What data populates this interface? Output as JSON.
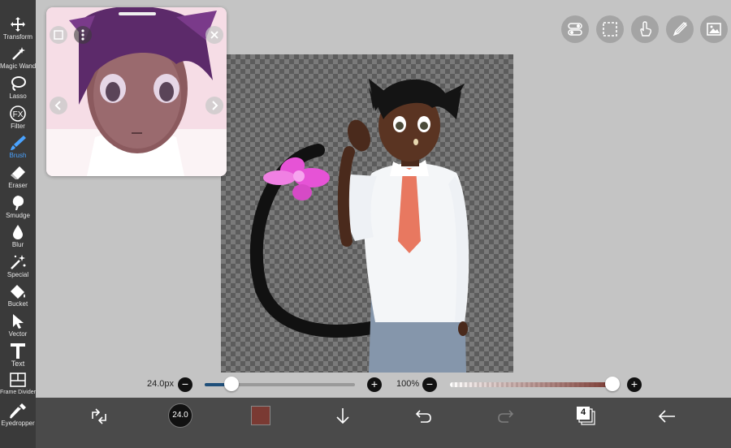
{
  "toolbar": {
    "tools": [
      {
        "label": "Transform",
        "icon": "move-arrows-icon"
      },
      {
        "label": "Magic Wand",
        "icon": "magic-wand-icon"
      },
      {
        "label": "Lasso",
        "icon": "lasso-icon"
      },
      {
        "label": "Filter",
        "icon": "fx-icon"
      },
      {
        "label": "Brush",
        "icon": "brush-icon",
        "active": true
      },
      {
        "label": "Eraser",
        "icon": "eraser-icon"
      },
      {
        "label": "Smudge",
        "icon": "smudge-icon"
      },
      {
        "label": "Blur",
        "icon": "drop-icon"
      },
      {
        "label": "Special",
        "icon": "sparkle-icon"
      },
      {
        "label": "Bucket",
        "icon": "bucket-icon"
      },
      {
        "label": "Vector",
        "icon": "cursor-icon"
      },
      {
        "label": "Text",
        "icon": "text-t-icon"
      },
      {
        "label": "Frame Divider",
        "icon": "frame-divider-icon"
      },
      {
        "label": "Eyedropper",
        "icon": "eyedropper-icon"
      }
    ],
    "active_color": "#4aa3ff"
  },
  "top_right_buttons": [
    "layer-toggle-icon",
    "selection-icon",
    "touch-hand-icon",
    "ruler-pen-icon",
    "image-icon"
  ],
  "brush_size": {
    "value_label": "24.0px",
    "level_percent": 17
  },
  "opacity": {
    "value_label": "100%",
    "level_percent": 100
  },
  "bottom_bar": {
    "brush_preview_label": "24.0",
    "current_color": "#7a3a33",
    "layers_count": "4"
  }
}
